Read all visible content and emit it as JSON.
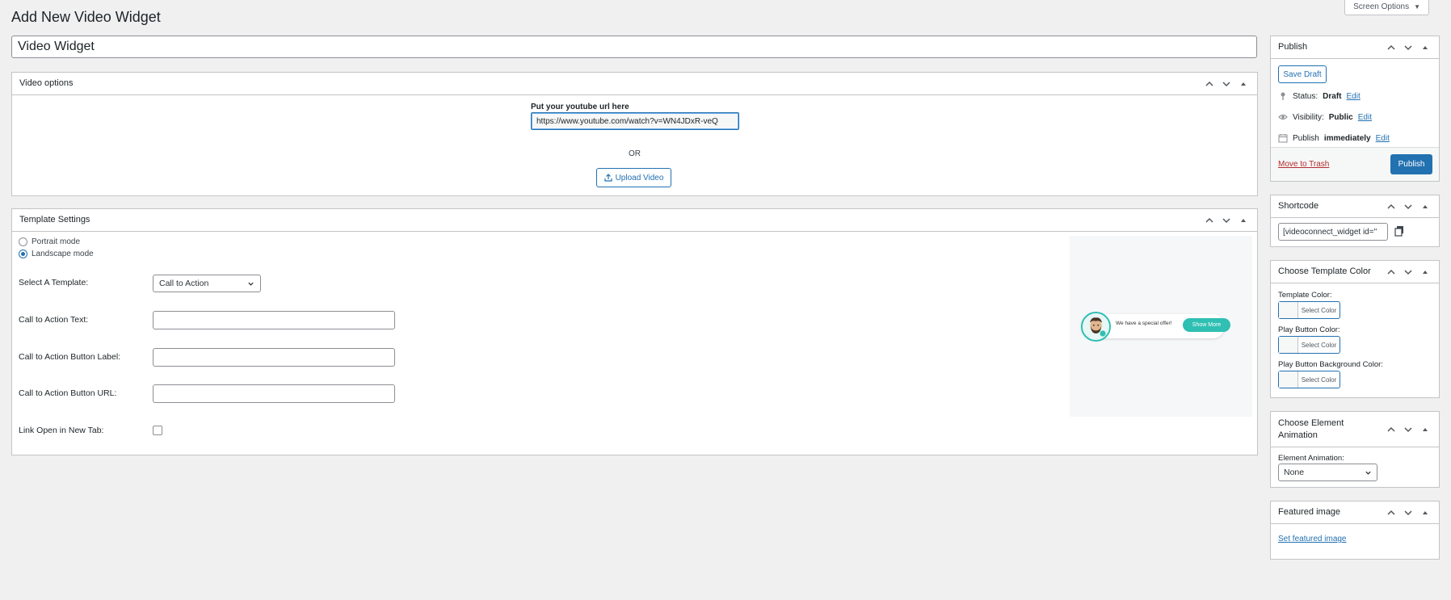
{
  "screen_options": {
    "label": "Screen Options"
  },
  "page": {
    "title": "Add New Video Widget",
    "post_title_value": "Video Widget"
  },
  "video_options": {
    "header": "Video options",
    "yt_label": "Put your youtube url here",
    "yt_value": "https://www.youtube.com/watch?v=WN4JDxR-veQ",
    "or_text": "OR",
    "upload_label": "Upload Video"
  },
  "template_settings": {
    "header": "Template Settings",
    "portrait_label": "Portrait mode",
    "landscape_label": "Landscape mode",
    "selected_mode": "landscape",
    "select_template_label": "Select A Template:",
    "select_template_value": "Call to Action",
    "cta_text_label": "Call to Action Text:",
    "cta_button_label_label": "Call to Action Button Label:",
    "cta_button_url_label": "Call to Action Button URL:",
    "link_new_tab_label": "Link Open in New Tab:",
    "preview": {
      "text": "We have a special offer!",
      "button": "Show More",
      "accent": "#2fbfb3"
    }
  },
  "publish": {
    "header": "Publish",
    "save_draft": "Save Draft",
    "status_label": "Status:",
    "status_value": "Draft",
    "visibility_label": "Visibility:",
    "visibility_value": "Public",
    "publish_label": "Publish",
    "publish_value": "immediately",
    "edit": "Edit",
    "move_to_trash": "Move to Trash",
    "publish_button": "Publish"
  },
  "shortcode": {
    "header": "Shortcode",
    "value": "[videoconnect_widget id=\""
  },
  "template_color": {
    "header": "Choose Template Color",
    "template_color_label": "Template Color:",
    "play_button_color_label": "Play Button Color:",
    "play_button_bg_label": "Play Button Background Color:",
    "select_color": "Select Color"
  },
  "element_animation": {
    "header": "Choose Element Animation",
    "label": "Element Animation:",
    "value": "None"
  },
  "featured_image": {
    "header": "Featured image",
    "link": "Set featured image"
  },
  "colors": {
    "primary": "#2271b1",
    "danger": "#b32d2e",
    "border": "#c3c4c7",
    "bg": "#f0f0f1"
  }
}
